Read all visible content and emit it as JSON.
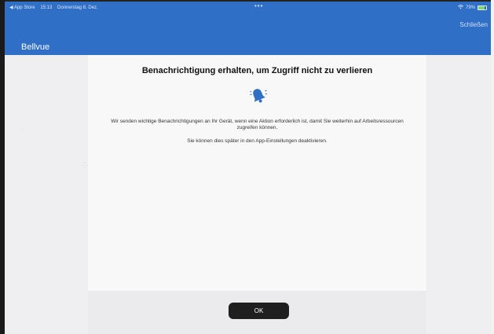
{
  "status_bar": {
    "back_app": "◀ App Store",
    "time": "15:13",
    "date": "Donnerstag 8. Dez.",
    "dots": "•••",
    "wifi_icon": "wifi-icon",
    "battery_text": "79%",
    "battery_level": 0.79
  },
  "header": {
    "close_label": "Schließen",
    "app_title": "Bellvue",
    "color": "#2f6fc6"
  },
  "card": {
    "title": "Benachrichtigung erhalten, um Zugriff nicht zu verlieren",
    "icon": "bell-icon",
    "body": "Wir senden wichtige Benachrichtigungen an Ihr Gerät, wenn eine Aktion erforderlich ist, damit Sie weiterhin auf Arbeitsressourcen zugreifen können.",
    "note": "Sie können dies später in den App-Einstellungen deaktivieren."
  },
  "footer": {
    "ok_label": "OK"
  }
}
